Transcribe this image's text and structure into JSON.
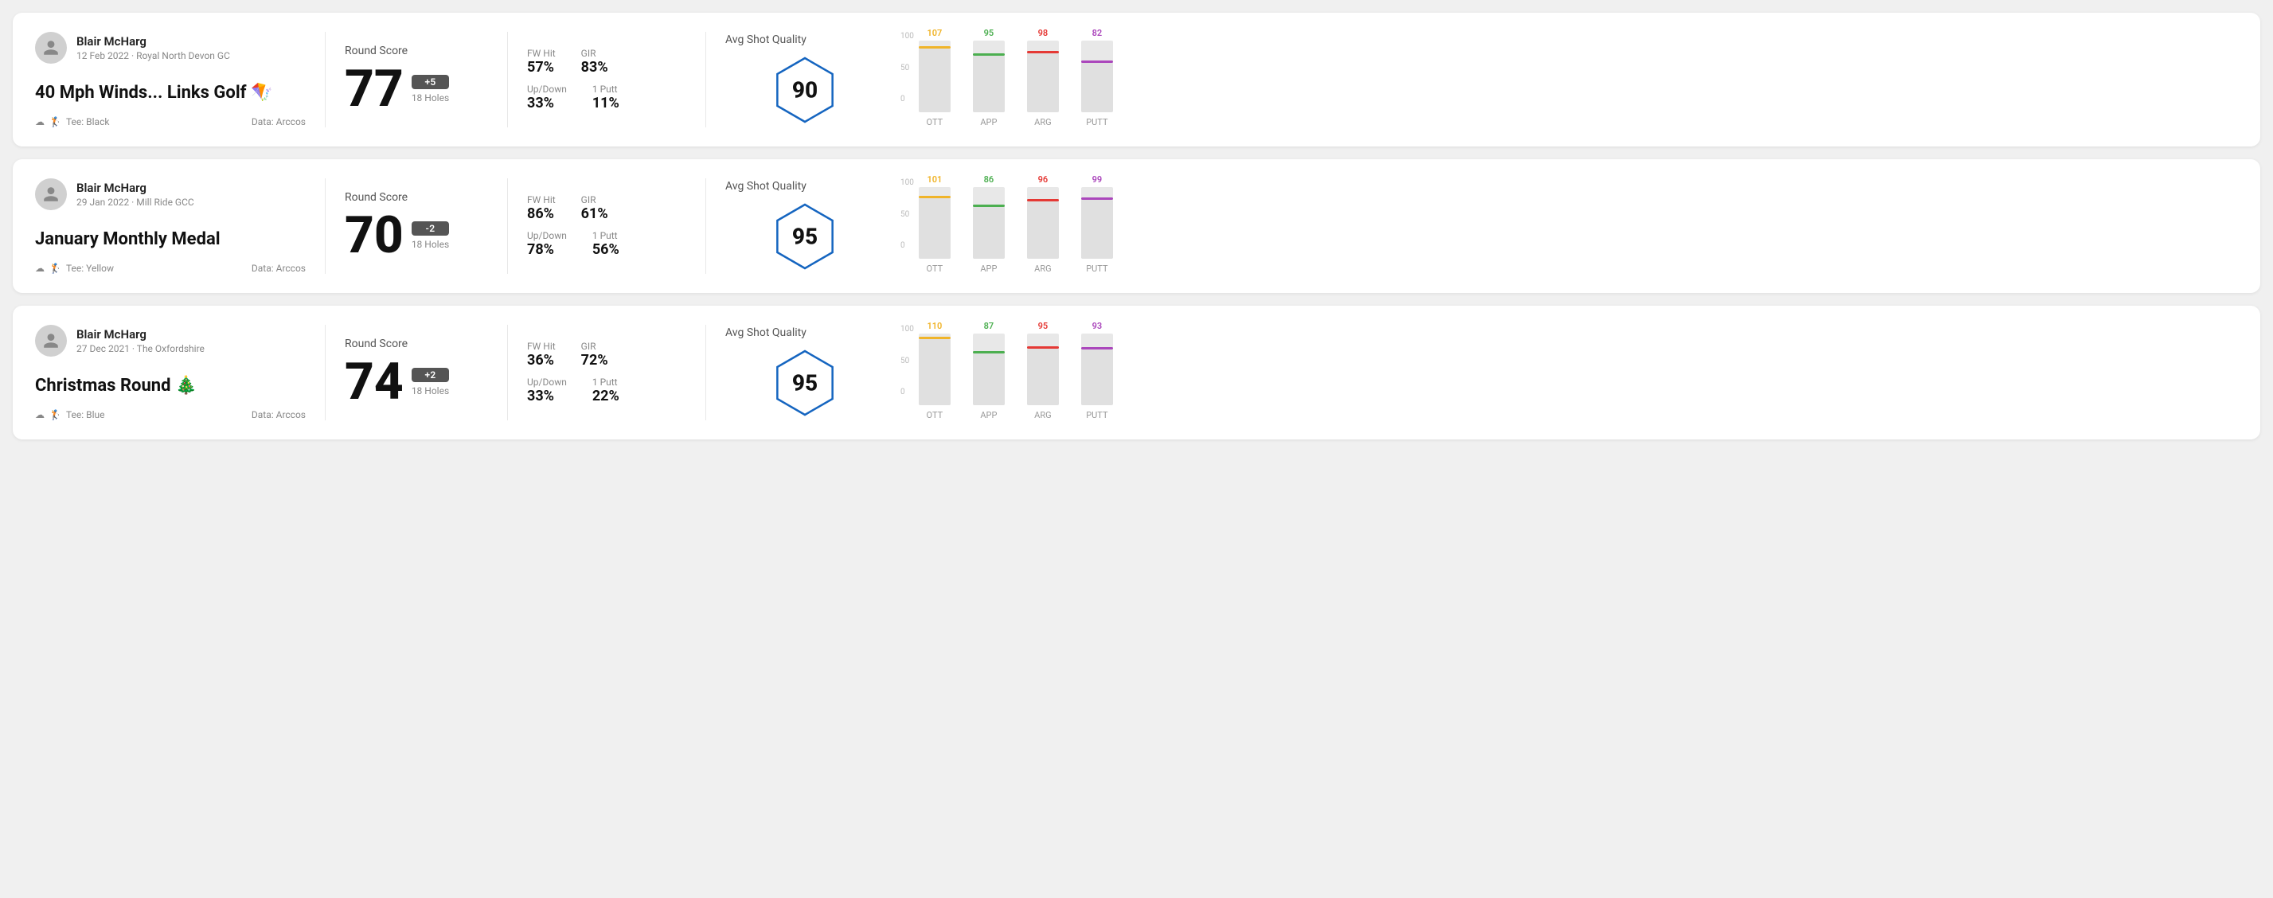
{
  "cards": [
    {
      "id": "card1",
      "user": {
        "name": "Blair McHarg",
        "date": "12 Feb 2022 · Royal North Devon GC"
      },
      "title": "40 Mph Winds... Links Golf",
      "title_emoji": "🪁",
      "tee": "Black",
      "data_source": "Data: Arccos",
      "round_score_label": "Round Score",
      "score": "77",
      "score_diff": "+5",
      "holes": "18 Holes",
      "fw_hit_label": "FW Hit",
      "fw_hit": "57%",
      "gir_label": "GIR",
      "gir": "83%",
      "updown_label": "Up/Down",
      "updown": "33%",
      "oneputt_label": "1 Putt",
      "oneputt": "11%",
      "quality_label": "Avg Shot Quality",
      "quality_score": "90",
      "chart": {
        "bars": [
          {
            "label": "OTT",
            "value": 107,
            "color": "#f0b429",
            "max": 120
          },
          {
            "label": "APP",
            "value": 95,
            "color": "#4caf50",
            "max": 120
          },
          {
            "label": "ARG",
            "value": 98,
            "color": "#e53935",
            "max": 120
          },
          {
            "label": "PUTT",
            "value": 82,
            "color": "#ab47bc",
            "max": 120
          }
        ]
      }
    },
    {
      "id": "card2",
      "user": {
        "name": "Blair McHarg",
        "date": "29 Jan 2022 · Mill Ride GCC"
      },
      "title": "January Monthly Medal",
      "title_emoji": "",
      "tee": "Yellow",
      "data_source": "Data: Arccos",
      "round_score_label": "Round Score",
      "score": "70",
      "score_diff": "-2",
      "holes": "18 Holes",
      "fw_hit_label": "FW Hit",
      "fw_hit": "86%",
      "gir_label": "GIR",
      "gir": "61%",
      "updown_label": "Up/Down",
      "updown": "78%",
      "oneputt_label": "1 Putt",
      "oneputt": "56%",
      "quality_label": "Avg Shot Quality",
      "quality_score": "95",
      "chart": {
        "bars": [
          {
            "label": "OTT",
            "value": 101,
            "color": "#f0b429",
            "max": 120
          },
          {
            "label": "APP",
            "value": 86,
            "color": "#4caf50",
            "max": 120
          },
          {
            "label": "ARG",
            "value": 96,
            "color": "#e53935",
            "max": 120
          },
          {
            "label": "PUTT",
            "value": 99,
            "color": "#ab47bc",
            "max": 120
          }
        ]
      }
    },
    {
      "id": "card3",
      "user": {
        "name": "Blair McHarg",
        "date": "27 Dec 2021 · The Oxfordshire"
      },
      "title": "Christmas Round",
      "title_emoji": "🎄",
      "tee": "Blue",
      "data_source": "Data: Arccos",
      "round_score_label": "Round Score",
      "score": "74",
      "score_diff": "+2",
      "holes": "18 Holes",
      "fw_hit_label": "FW Hit",
      "fw_hit": "36%",
      "gir_label": "GIR",
      "gir": "72%",
      "updown_label": "Up/Down",
      "updown": "33%",
      "oneputt_label": "1 Putt",
      "oneputt": "22%",
      "quality_label": "Avg Shot Quality",
      "quality_score": "95",
      "chart": {
        "bars": [
          {
            "label": "OTT",
            "value": 110,
            "color": "#f0b429",
            "max": 120
          },
          {
            "label": "APP",
            "value": 87,
            "color": "#4caf50",
            "max": 120
          },
          {
            "label": "ARG",
            "value": 95,
            "color": "#e53935",
            "max": 120
          },
          {
            "label": "PUTT",
            "value": 93,
            "color": "#ab47bc",
            "max": 120
          }
        ]
      }
    }
  ],
  "y_axis_labels": [
    "100",
    "50",
    "0"
  ]
}
